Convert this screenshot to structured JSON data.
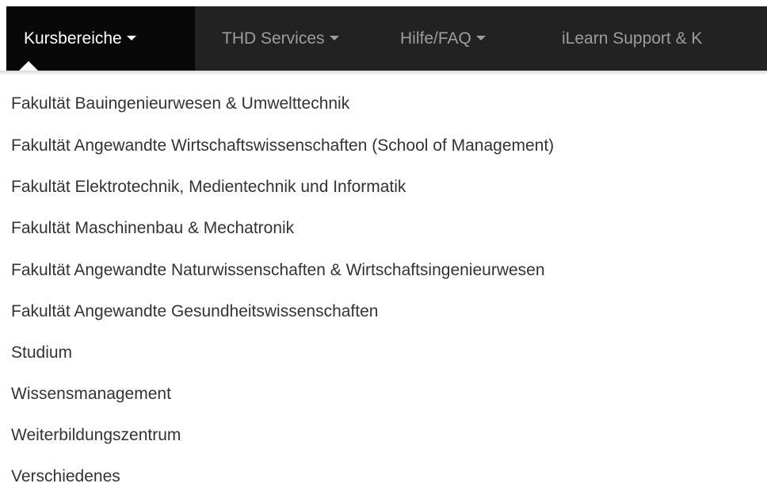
{
  "navbar": {
    "items": [
      {
        "label": "Kursbereiche",
        "active": true
      },
      {
        "label": "THD Services",
        "active": false
      },
      {
        "label": "Hilfe/FAQ",
        "active": false
      },
      {
        "label": "iLearn Support & K",
        "active": false
      }
    ]
  },
  "dropdown": {
    "items": [
      {
        "label": "Fakultät Bauingenieurwesen & Umwelttechnik"
      },
      {
        "label": "Fakultät Angewandte Wirtschaftswissenschaften (School of Management)"
      },
      {
        "label": "Fakultät Elektrotechnik, Medientechnik und Informatik"
      },
      {
        "label": "Fakultät Maschinenbau & Mechatronik"
      },
      {
        "label": "Fakultät Angewandte Naturwissenschaften & Wirtschaftsingenieurwesen"
      },
      {
        "label": "Fakultät Angewandte Gesundheitswissenschaften"
      },
      {
        "label": "Studium"
      },
      {
        "label": "Wissensmanagement"
      },
      {
        "label": "Weiterbildungszentrum"
      },
      {
        "label": "Verschiedenes"
      }
    ]
  },
  "colors": {
    "navbar_bg": "#222222",
    "navbar_active_bg": "#080808",
    "nav_text": "#9d9d9d",
    "nav_active_text": "#ffffff",
    "dropdown_text": "#333333"
  }
}
